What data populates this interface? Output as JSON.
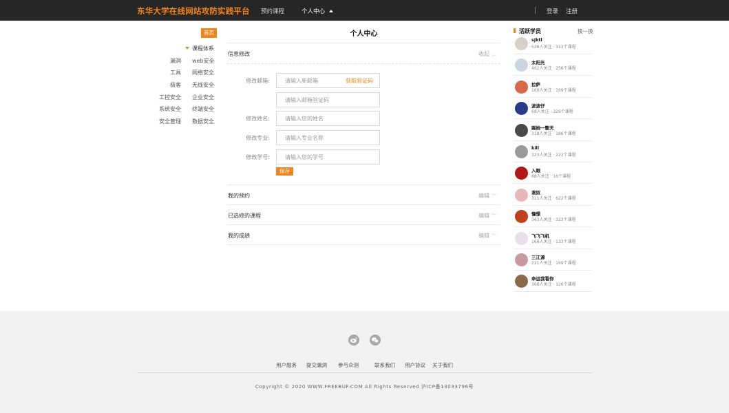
{
  "header": {
    "brand": "东华大学在线网站攻防实践平台",
    "nav": {
      "booking": "预约课程",
      "personal": "个人中心"
    },
    "login": "登录",
    "register": "注册"
  },
  "sidebar": {
    "home": "首页",
    "courses_title": "课程体系",
    "categories": [
      "漏洞",
      "web安全",
      "工具",
      "网络安全",
      "极客",
      "无线安全",
      "工控安全",
      "企业安全",
      "系统安全",
      "终端安全",
      "安全管理",
      "数据安全"
    ]
  },
  "main": {
    "title": "个人中心",
    "info_section": {
      "title": "信息修改",
      "action": "收起"
    },
    "form": {
      "email_label": "修改邮箱:",
      "email_placeholder": "请输入新邮箱",
      "get_code": "获取验证码",
      "code_placeholder": "请输入邮箱验证码",
      "name_label": "修改姓名:",
      "name_placeholder": "请输入您的姓名",
      "major_label": "修改专业:",
      "major_placeholder": "请输入专业名称",
      "sid_label": "修改学号:",
      "sid_placeholder": "请输入您的学号",
      "save": "保存"
    },
    "sections": [
      {
        "title": "我的预约",
        "action": "编辑"
      },
      {
        "title": "已选修的课程",
        "action": "编辑"
      },
      {
        "title": "我的成绩",
        "action": "编辑"
      }
    ]
  },
  "right": {
    "title": "活跃学员",
    "refresh": "换一换",
    "learners": [
      {
        "name": "sjktl",
        "stats": "538人关注 · 313个课程",
        "avatar_color": "#d8d0c8"
      },
      {
        "name": "太阳光",
        "stats": "462人关注 · 256个课程",
        "avatar_color": "#c8d6e0"
      },
      {
        "name": "拉萨",
        "stats": "169人关注 · 169个课程",
        "avatar_color": "#d86a4a"
      },
      {
        "name": "波波仔",
        "stats": "68人关注 · 326个课程",
        "avatar_color": "#2a3a8a"
      },
      {
        "name": "踢她一整天",
        "stats": "318人关注 · 186个课程",
        "avatar_color": "#4a4a4a"
      },
      {
        "name": "kill",
        "stats": "323人关注 · 223个课程",
        "avatar_color": "#9a9a9a"
      },
      {
        "name": "入眼",
        "stats": "68人关注 · 16个课程",
        "avatar_color": "#b01818"
      },
      {
        "name": "滚奴",
        "stats": "311人关注 · 622个课程",
        "avatar_color": "#e8b8b8"
      },
      {
        "name": "憧憬",
        "stats": "363人关注 · 323个课程",
        "avatar_color": "#c0401a"
      },
      {
        "name": "飞飞飞机",
        "stats": "168人关注 · 133个课程",
        "avatar_color": "#e8e0e8"
      },
      {
        "name": "三江源",
        "stats": "221人关注 · 169个课程",
        "avatar_color": "#c89aa0"
      },
      {
        "name": "命运我看你",
        "stats": "368人关注 · 126个课程",
        "avatar_color": "#8a6a4a"
      }
    ]
  },
  "footer": {
    "links": [
      "用户服务",
      "提交漏洞",
      "参与众测",
      "联系我们",
      "用户协议",
      "关于我们"
    ],
    "copyright": "Copyright © 2020 WWW.FREEBUF.COM All Rights Reserved 沪ICP备13033796号",
    "icons": [
      "weibo-icon",
      "wechat-icon"
    ]
  },
  "colors": {
    "accent": "#f08519",
    "topbar": "#262626",
    "footer_bg": "#f2f2f2"
  }
}
